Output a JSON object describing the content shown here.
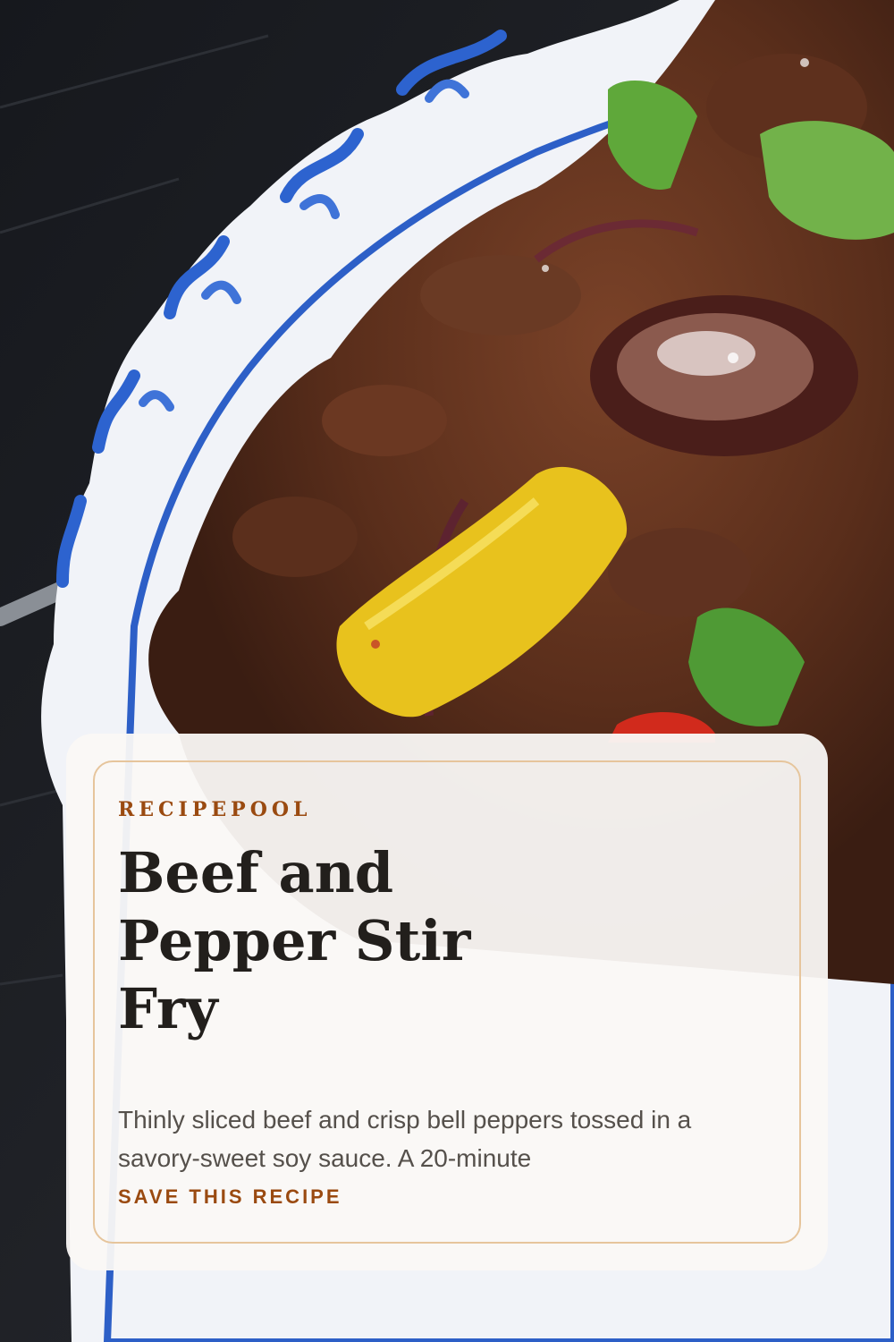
{
  "pin": {
    "brand": "RECIPEPOOL",
    "title": "Beef and Pepper Stir Fry",
    "description": "Thinly sliced beef and crisp bell peppers tossed in a savory-sweet soy sauce. A 20-minute",
    "cta": "SAVE THIS RECIPE"
  },
  "colors": {
    "background": "#1b1d22",
    "card": "#faf8f5",
    "card_border": "#e6c59c",
    "accent": "#9a4a10",
    "title": "#221f1c",
    "body_text": "#55504b"
  }
}
